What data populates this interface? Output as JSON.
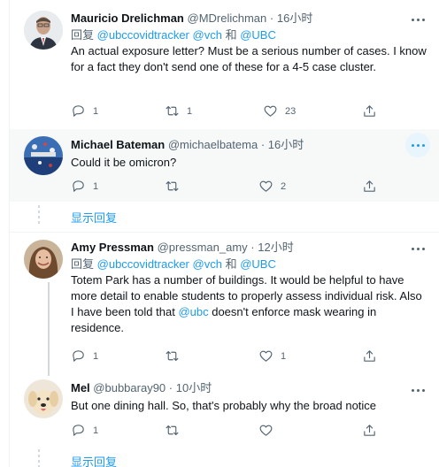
{
  "tweets": [
    {
      "name": "Mauricio Drelichman",
      "handle": "@MDrelichman",
      "dot": "·",
      "time": "16小时",
      "reply_label": "回复",
      "reply_to": [
        "@ubccovidtracker",
        "@vch",
        "@UBC"
      ],
      "reply_and": "和",
      "text": "An actual exposure letter? Must be a serious number of cases. I know for a fact they don't send one of these for a 4-5 case cluster.",
      "reply_count": "1",
      "retweet_count": "1",
      "like_count": "23"
    },
    {
      "name": "Michael Bateman",
      "handle": "@michaelbatema",
      "dot": "·",
      "time": "16小时",
      "text": "Could it be omicron?",
      "reply_count": "1",
      "retweet_count": "",
      "like_count": "2"
    },
    {
      "name": "Amy Pressman",
      "handle": "@pressman_amy",
      "dot": "·",
      "time": "12小时",
      "reply_label": "回复",
      "reply_to": [
        "@ubccovidtracker",
        "@vch",
        "@UBC"
      ],
      "reply_and": "和",
      "text_before": "Totem Park has a number of buildings.  It would be helpful to have more detail to enable students to properly assess individual risk. Also I have been told that ",
      "text_mention": "@ubc",
      "text_after": " doesn't enforce mask wearing in residence.",
      "reply_count": "1",
      "retweet_count": "",
      "like_count": "1"
    },
    {
      "name": "Mel",
      "handle": "@bubbaray90",
      "dot": "·",
      "time": "10小时",
      "text": "But one dining hall. So, that's probably why the broad notice",
      "reply_count": "1",
      "retweet_count": "",
      "like_count": ""
    }
  ],
  "show_replies_label": "显示回复",
  "colors": {
    "accent": "#1d9bf0",
    "muted": "#536471",
    "text": "#0f1419"
  },
  "icons": [
    "reply-icon",
    "retweet-icon",
    "like-icon",
    "share-icon",
    "more-icon"
  ]
}
